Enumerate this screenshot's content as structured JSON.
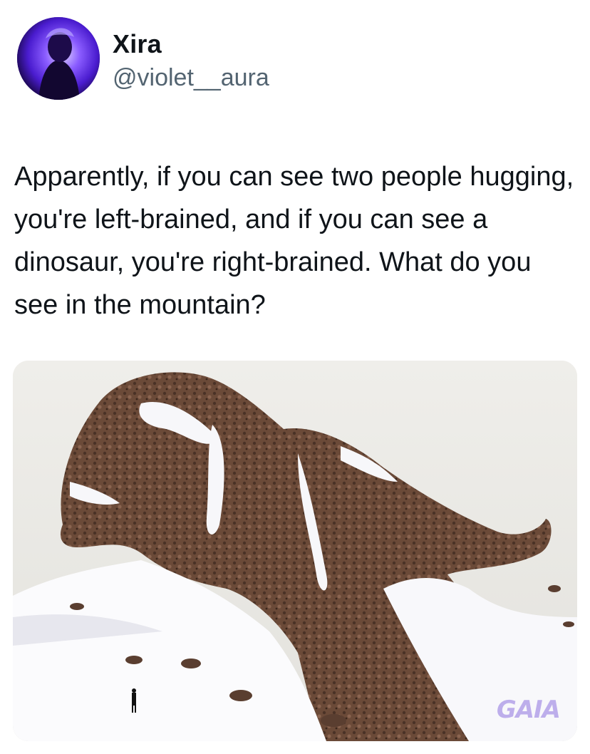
{
  "tweet": {
    "author": {
      "display_name": "Xira",
      "handle": "@violet__aura",
      "avatar_icon": "profile-photo-purple"
    },
    "text": "Apparently, if you can see two people hugging, you're left-brained, and if you can see a dinosaur, you're right-brained. What do you see in the mountain?",
    "media": {
      "type": "photo",
      "subject": "snowy rock mountain resembling a dinosaur or two people hugging",
      "watermark": "GAIA",
      "colors": {
        "sky": "#ecebe6",
        "rock": "#6b4a38",
        "snow": "#fbfbfd"
      }
    }
  }
}
